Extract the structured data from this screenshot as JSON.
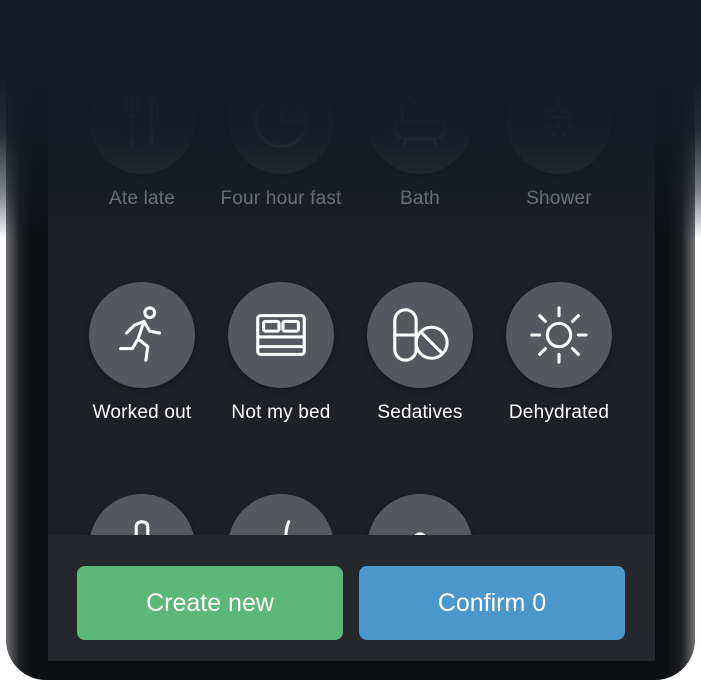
{
  "rows": {
    "faded": [
      {
        "label": "Ate late",
        "icon": "fork-knife-icon"
      },
      {
        "label": "Four hour fast",
        "icon": "clock-fast-icon"
      },
      {
        "label": "Bath",
        "icon": "bathtub-icon"
      },
      {
        "label": "Shower",
        "icon": "shower-icon"
      }
    ],
    "active": [
      {
        "label": "Worked out",
        "icon": "running-person-icon"
      },
      {
        "label": "Not my bed",
        "icon": "bed-icon"
      },
      {
        "label": "Sedatives",
        "icon": "pills-icon"
      },
      {
        "label": "Dehydrated",
        "icon": "sun-icon"
      }
    ],
    "partial": [
      {
        "label": "",
        "icon": "thermometer-icon"
      },
      {
        "label": "",
        "icon": "utensil-icon"
      },
      {
        "label": "",
        "icon": "leaf-icon"
      }
    ]
  },
  "buttons": {
    "create_label": "Create new",
    "confirm_label": "Confirm 0"
  },
  "colors": {
    "create": "#5cb87a",
    "confirm": "#4b97cc",
    "circle": "#55585f",
    "background": "#1e2025"
  }
}
